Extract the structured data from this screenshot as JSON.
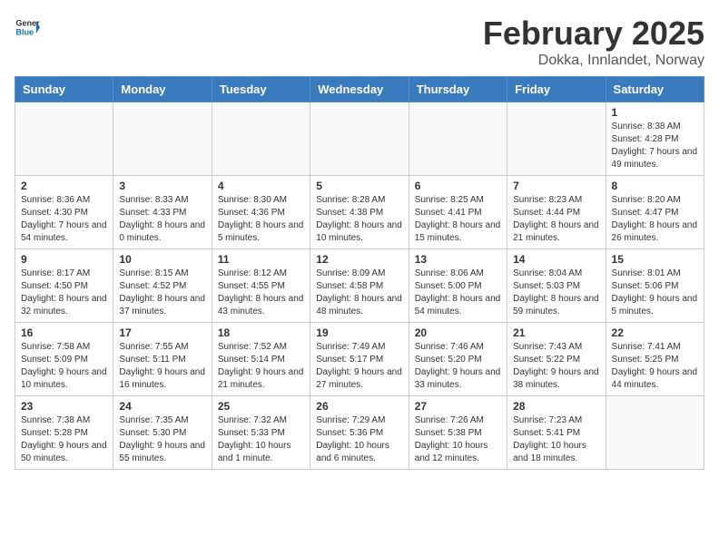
{
  "header": {
    "logo_general": "General",
    "logo_blue": "Blue",
    "month_year": "February 2025",
    "location": "Dokka, Innlandet, Norway"
  },
  "days_of_week": [
    "Sunday",
    "Monday",
    "Tuesday",
    "Wednesday",
    "Thursday",
    "Friday",
    "Saturday"
  ],
  "weeks": [
    [
      {
        "day": "",
        "info": ""
      },
      {
        "day": "",
        "info": ""
      },
      {
        "day": "",
        "info": ""
      },
      {
        "day": "",
        "info": ""
      },
      {
        "day": "",
        "info": ""
      },
      {
        "day": "",
        "info": ""
      },
      {
        "day": "1",
        "info": "Sunrise: 8:38 AM\nSunset: 4:28 PM\nDaylight: 7 hours and 49 minutes."
      }
    ],
    [
      {
        "day": "2",
        "info": "Sunrise: 8:36 AM\nSunset: 4:30 PM\nDaylight: 7 hours and 54 minutes."
      },
      {
        "day": "3",
        "info": "Sunrise: 8:33 AM\nSunset: 4:33 PM\nDaylight: 8 hours and 0 minutes."
      },
      {
        "day": "4",
        "info": "Sunrise: 8:30 AM\nSunset: 4:36 PM\nDaylight: 8 hours and 5 minutes."
      },
      {
        "day": "5",
        "info": "Sunrise: 8:28 AM\nSunset: 4:38 PM\nDaylight: 8 hours and 10 minutes."
      },
      {
        "day": "6",
        "info": "Sunrise: 8:25 AM\nSunset: 4:41 PM\nDaylight: 8 hours and 15 minutes."
      },
      {
        "day": "7",
        "info": "Sunrise: 8:23 AM\nSunset: 4:44 PM\nDaylight: 8 hours and 21 minutes."
      },
      {
        "day": "8",
        "info": "Sunrise: 8:20 AM\nSunset: 4:47 PM\nDaylight: 8 hours and 26 minutes."
      }
    ],
    [
      {
        "day": "9",
        "info": "Sunrise: 8:17 AM\nSunset: 4:50 PM\nDaylight: 8 hours and 32 minutes."
      },
      {
        "day": "10",
        "info": "Sunrise: 8:15 AM\nSunset: 4:52 PM\nDaylight: 8 hours and 37 minutes."
      },
      {
        "day": "11",
        "info": "Sunrise: 8:12 AM\nSunset: 4:55 PM\nDaylight: 8 hours and 43 minutes."
      },
      {
        "day": "12",
        "info": "Sunrise: 8:09 AM\nSunset: 4:58 PM\nDaylight: 8 hours and 48 minutes."
      },
      {
        "day": "13",
        "info": "Sunrise: 8:06 AM\nSunset: 5:00 PM\nDaylight: 8 hours and 54 minutes."
      },
      {
        "day": "14",
        "info": "Sunrise: 8:04 AM\nSunset: 5:03 PM\nDaylight: 8 hours and 59 minutes."
      },
      {
        "day": "15",
        "info": "Sunrise: 8:01 AM\nSunset: 5:06 PM\nDaylight: 9 hours and 5 minutes."
      }
    ],
    [
      {
        "day": "16",
        "info": "Sunrise: 7:58 AM\nSunset: 5:09 PM\nDaylight: 9 hours and 10 minutes."
      },
      {
        "day": "17",
        "info": "Sunrise: 7:55 AM\nSunset: 5:11 PM\nDaylight: 9 hours and 16 minutes."
      },
      {
        "day": "18",
        "info": "Sunrise: 7:52 AM\nSunset: 5:14 PM\nDaylight: 9 hours and 21 minutes."
      },
      {
        "day": "19",
        "info": "Sunrise: 7:49 AM\nSunset: 5:17 PM\nDaylight: 9 hours and 27 minutes."
      },
      {
        "day": "20",
        "info": "Sunrise: 7:46 AM\nSunset: 5:20 PM\nDaylight: 9 hours and 33 minutes."
      },
      {
        "day": "21",
        "info": "Sunrise: 7:43 AM\nSunset: 5:22 PM\nDaylight: 9 hours and 38 minutes."
      },
      {
        "day": "22",
        "info": "Sunrise: 7:41 AM\nSunset: 5:25 PM\nDaylight: 9 hours and 44 minutes."
      }
    ],
    [
      {
        "day": "23",
        "info": "Sunrise: 7:38 AM\nSunset: 5:28 PM\nDaylight: 9 hours and 50 minutes."
      },
      {
        "day": "24",
        "info": "Sunrise: 7:35 AM\nSunset: 5:30 PM\nDaylight: 9 hours and 55 minutes."
      },
      {
        "day": "25",
        "info": "Sunrise: 7:32 AM\nSunset: 5:33 PM\nDaylight: 10 hours and 1 minute."
      },
      {
        "day": "26",
        "info": "Sunrise: 7:29 AM\nSunset: 5:36 PM\nDaylight: 10 hours and 6 minutes."
      },
      {
        "day": "27",
        "info": "Sunrise: 7:26 AM\nSunset: 5:38 PM\nDaylight: 10 hours and 12 minutes."
      },
      {
        "day": "28",
        "info": "Sunrise: 7:23 AM\nSunset: 5:41 PM\nDaylight: 10 hours and 18 minutes."
      },
      {
        "day": "",
        "info": ""
      }
    ]
  ]
}
